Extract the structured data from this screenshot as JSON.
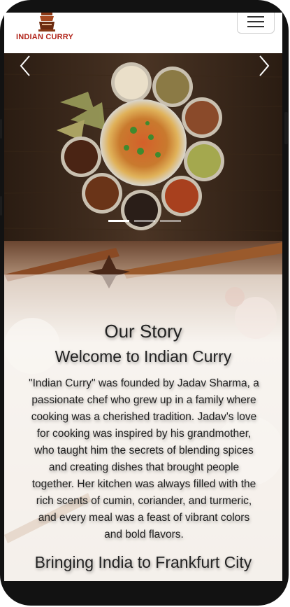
{
  "navbar": {
    "brand": "INDIAN CURRY",
    "logo_icon": "chef-pot-logo-icon",
    "menu_icon": "hamburger-menu-icon"
  },
  "carousel": {
    "prev_icon": "chevron-left-icon",
    "next_icon": "chevron-right-icon",
    "slide_count": 3,
    "active_slide": 1
  },
  "story": {
    "heading": "Our Story",
    "subheading": "Welcome to Indian Curry",
    "paragraph": "\"Indian Curry\" was founded by Jadav Sharma, a passionate chef who grew up in a family where cooking was a cherished tradition. Jadav's love for cooking was inspired by his grandmother, who taught him the secrets of blending spices and creating dishes that brought people together. Her kitchen was always filled with the rich scents of cumin, coriander, and turmeric, and every meal was a feast of vibrant colors and bold flavors.",
    "next_heading": "Bringing India to Frankfurt City"
  },
  "colors": {
    "brand": "#b2261c",
    "phone_frame": "#121212"
  }
}
